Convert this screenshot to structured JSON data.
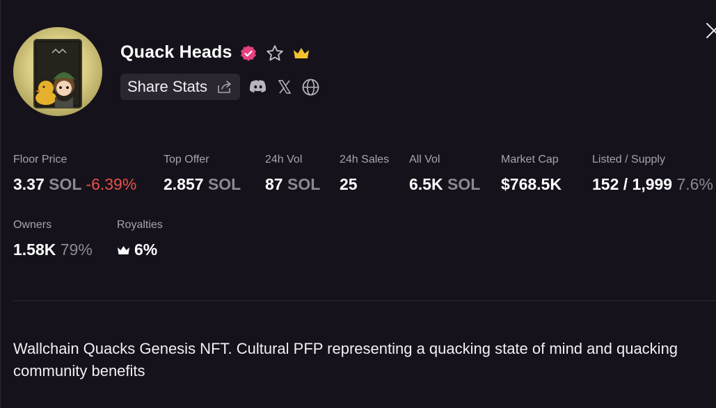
{
  "collection": {
    "name": "Quack Heads",
    "description": "Wallchain Quacks Genesis NFT. Cultural PFP representing a quacking state of mind and quacking community benefits"
  },
  "share": {
    "label": "Share Stats"
  },
  "stats": {
    "floor_price": {
      "label": "Floor Price",
      "value": "3.37",
      "unit": "SOL",
      "change": "-6.39%"
    },
    "top_offer": {
      "label": "Top Offer",
      "value": "2.857",
      "unit": "SOL"
    },
    "vol_24h": {
      "label": "24h Vol",
      "value": "87",
      "unit": "SOL"
    },
    "sales_24h": {
      "label": "24h Sales",
      "value": "25"
    },
    "all_vol": {
      "label": "All Vol",
      "value": "6.5K",
      "unit": "SOL"
    },
    "market_cap": {
      "label": "Market Cap",
      "value": "$768.5K"
    },
    "listed_supply": {
      "label": "Listed / Supply",
      "value": "152 / 1,999",
      "percent": "7.6%"
    },
    "owners": {
      "label": "Owners",
      "value": "1.58K",
      "percent": "79%"
    },
    "royalties": {
      "label": "Royalties",
      "value": "6%"
    }
  },
  "icons": {
    "verified": "verified-badge-icon",
    "favorite": "star-icon",
    "premium": "crown-icon",
    "share": "share-icon",
    "discord": "discord-icon",
    "x": "x-icon",
    "website": "globe-icon",
    "close": "close-icon"
  },
  "colors": {
    "background": "#16121b",
    "verified": "#e5427f",
    "crown": "#f2c12e",
    "negative": "#e5524a",
    "muted": "#8d8894"
  }
}
